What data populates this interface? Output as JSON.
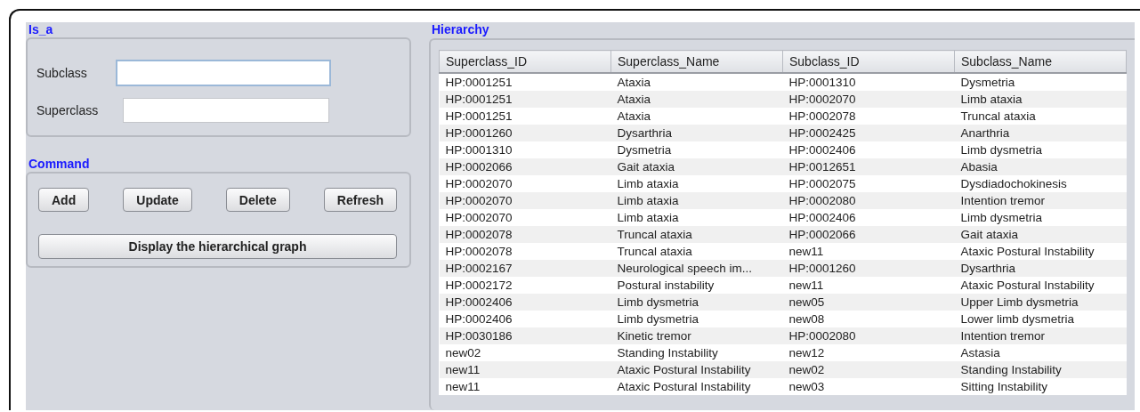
{
  "is_a": {
    "title": "Is_a",
    "fields": [
      {
        "label": "Subclass",
        "focused": true
      },
      {
        "label": "Superclass",
        "focused": false
      }
    ]
  },
  "command": {
    "title": "Command",
    "buttons": [
      "Add",
      "Update",
      "Delete",
      "Refresh"
    ],
    "wide_button": "Display the hierarchical  graph"
  },
  "hierarchy": {
    "title": "Hierarchy",
    "table": {
      "columns": [
        "Superclass_ID",
        "Superclass_Name",
        "Subclass_ID",
        "Subclass_Name"
      ],
      "rows": [
        [
          "HP:0001251",
          "Ataxia",
          "HP:0001310",
          "Dysmetria"
        ],
        [
          "HP:0001251",
          "Ataxia",
          "HP:0002070",
          "Limb ataxia"
        ],
        [
          "HP:0001251",
          "Ataxia",
          "HP:0002078",
          "Truncal ataxia"
        ],
        [
          "HP:0001260",
          "Dysarthria",
          "HP:0002425",
          "Anarthria"
        ],
        [
          "HP:0001310",
          "Dysmetria",
          "HP:0002406",
          "Limb dysmetria"
        ],
        [
          "HP:0002066",
          "Gait ataxia",
          "HP:0012651",
          "Abasia"
        ],
        [
          "HP:0002070",
          "Limb ataxia",
          "HP:0002075",
          "Dysdiadochokinesis"
        ],
        [
          "HP:0002070",
          "Limb ataxia",
          "HP:0002080",
          "Intention tremor"
        ],
        [
          "HP:0002070",
          "Limb ataxia",
          "HP:0002406",
          "Limb dysmetria"
        ],
        [
          "HP:0002078",
          "Truncal ataxia",
          "HP:0002066",
          "Gait ataxia"
        ],
        [
          "HP:0002078",
          "Truncal ataxia",
          "new11",
          "Ataxic Postural Instability"
        ],
        [
          "HP:0002167",
          "Neurological speech im...",
          "HP:0001260",
          "Dysarthria"
        ],
        [
          "HP:0002172",
          "Postural instability",
          "new11",
          "Ataxic Postural Instability"
        ],
        [
          "HP:0002406",
          "Limb dysmetria",
          "new05",
          "Upper Limb dysmetria"
        ],
        [
          "HP:0002406",
          "Limb dysmetria",
          "new08",
          "Lower limb dysmetria"
        ],
        [
          "HP:0030186",
          "Kinetic tremor",
          "HP:0002080",
          "Intention tremor"
        ],
        [
          "new02",
          "Standing Instability",
          "new12",
          "Astasia"
        ],
        [
          "new11",
          "Ataxic Postural Instability",
          "new02",
          "Standing Instability"
        ],
        [
          "new11",
          "Ataxic Postural Instability",
          "new03",
          "Sitting Instability"
        ]
      ]
    }
  }
}
